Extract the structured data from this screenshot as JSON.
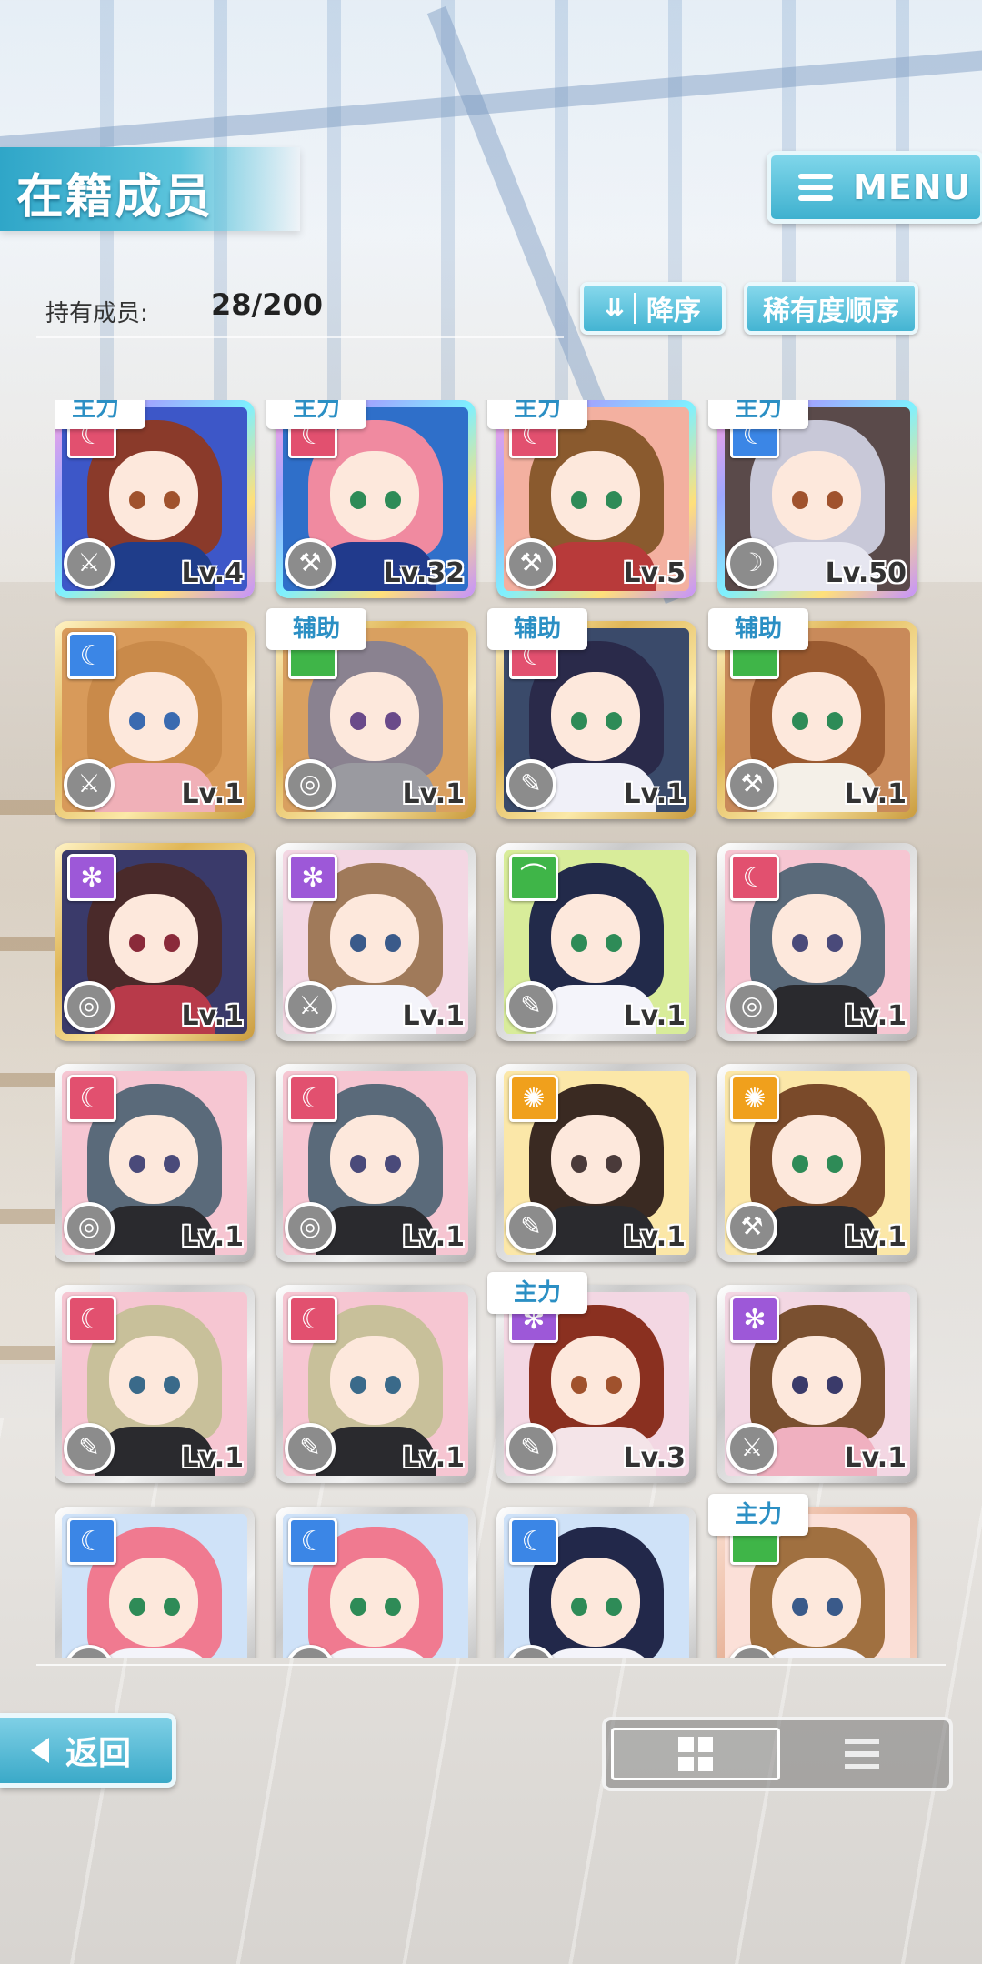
{
  "header": {
    "title": "在籍成员",
    "menu_label": "MENU"
  },
  "summary": {
    "count_label": "持有成员:",
    "count_value": "28/200"
  },
  "sort": {
    "order_label": "降序",
    "order_icon": "double-chevron-down-icon",
    "rarity_label": "稀有度顺序"
  },
  "members": [
    {
      "frame": "rainbow",
      "attribute": "red",
      "weapon": "sword",
      "level": "Lv.4",
      "role": "主力",
      "hair": "#8a3a2a",
      "outfit": "#1f3d8a",
      "eye": "#a0522d",
      "bg": "#3d57c8"
    },
    {
      "frame": "rainbow",
      "attribute": "red",
      "weapon": "hammer",
      "level": "Lv.32",
      "role": "主力",
      "hair": "#f08aa0",
      "outfit": "#213a8c",
      "eye": "#2e8b57",
      "bg": "#2f6fc9"
    },
    {
      "frame": "rainbow",
      "attribute": "red",
      "weapon": "hammer",
      "level": "Lv.5",
      "role": "主力",
      "hair": "#8a5a2e",
      "outfit": "#b83a3a",
      "eye": "#2e8b57",
      "bg": "#f3b0a0"
    },
    {
      "frame": "rainbow",
      "attribute": "blue",
      "weapon": "claw",
      "level": "Lv.50",
      "role": "主力",
      "hair": "#c8c8d8",
      "outfit": "#e6e6f0",
      "eye": "#a0522d",
      "bg": "#5a4a4a"
    },
    {
      "frame": "gold",
      "attribute": "blue",
      "weapon": "sword",
      "level": "Lv.1",
      "role": "",
      "hair": "#c98a4a",
      "outfit": "#f0b0b8",
      "eye": "#3a6ab0",
      "bg": "#d89a5a"
    },
    {
      "frame": "gold",
      "attribute": "green",
      "weapon": "shield",
      "level": "Lv.1",
      "role": "辅助",
      "hair": "#8a8290",
      "outfit": "#9a9aa0",
      "eye": "#6a4a8a",
      "bg": "#d9a060"
    },
    {
      "frame": "gold",
      "attribute": "red",
      "weapon": "gun",
      "level": "Lv.1",
      "role": "辅助",
      "hair": "#2a2a4a",
      "outfit": "#f0f0f8",
      "eye": "#2e8b57",
      "bg": "#3a4a6a"
    },
    {
      "frame": "gold",
      "attribute": "green",
      "weapon": "hammer",
      "level": "Lv.1",
      "role": "辅助",
      "hair": "#9a5a30",
      "outfit": "#f4f0e8",
      "eye": "#2e8b57",
      "bg": "#c98a5a"
    },
    {
      "frame": "gold",
      "attribute": "purple",
      "weapon": "shield",
      "level": "Lv.1",
      "role": "",
      "hair": "#4a2a2a",
      "outfit": "#b83a4a",
      "eye": "#8a2a3a",
      "bg": "#3a3a6a"
    },
    {
      "frame": "silver",
      "attribute": "purple",
      "weapon": "sword",
      "level": "Lv.1",
      "role": "",
      "hair": "#a07a5a",
      "outfit": "#f4f4fa",
      "eye": "#3a5a8a",
      "bg": "#f3d7e3"
    },
    {
      "frame": "silver",
      "attribute": "green",
      "weapon": "gun",
      "level": "Lv.1",
      "role": "",
      "hair": "#222a4a",
      "outfit": "#f4f4fa",
      "eye": "#2e8b57",
      "bg": "#d8ec9a"
    },
    {
      "frame": "silver",
      "attribute": "red",
      "weapon": "shield",
      "level": "Lv.1",
      "role": "",
      "hair": "#5a6a7a",
      "outfit": "#2a2a2e",
      "eye": "#4a4a7a",
      "bg": "#f6c6d2"
    },
    {
      "frame": "silver",
      "attribute": "red",
      "weapon": "shield",
      "level": "Lv.1",
      "role": "",
      "hair": "#5a6a7a",
      "outfit": "#2a2a2e",
      "eye": "#4a4a7a",
      "bg": "#f6c6d2"
    },
    {
      "frame": "silver",
      "attribute": "red",
      "weapon": "shield",
      "level": "Lv.1",
      "role": "",
      "hair": "#5a6a7a",
      "outfit": "#2a2a2e",
      "eye": "#4a4a7a",
      "bg": "#f6c6d2"
    },
    {
      "frame": "silver",
      "attribute": "orange",
      "weapon": "gun",
      "level": "Lv.1",
      "role": "",
      "hair": "#3a2a22",
      "outfit": "#2a2a2e",
      "eye": "#4a3a3a",
      "bg": "#fbe7a8"
    },
    {
      "frame": "silver",
      "attribute": "orange",
      "weapon": "hammer",
      "level": "Lv.1",
      "role": "",
      "hair": "#7a4a2a",
      "outfit": "#2a2a2e",
      "eye": "#2e8b57",
      "bg": "#fbe7a8"
    },
    {
      "frame": "silver",
      "attribute": "red",
      "weapon": "gun",
      "level": "Lv.1",
      "role": "",
      "hair": "#c8c09a",
      "outfit": "#2a2a2e",
      "eye": "#3a6a8a",
      "bg": "#f6c6d2"
    },
    {
      "frame": "silver",
      "attribute": "red",
      "weapon": "gun",
      "level": "Lv.1",
      "role": "",
      "hair": "#c8c09a",
      "outfit": "#2a2a2e",
      "eye": "#3a6a8a",
      "bg": "#f6c6d2"
    },
    {
      "frame": "silver",
      "attribute": "purple",
      "weapon": "gun",
      "level": "Lv.3",
      "role": "主力",
      "hair": "#8a3020",
      "outfit": "#f4e4e8",
      "eye": "#a0522d",
      "bg": "#f3d7e3"
    },
    {
      "frame": "silver",
      "attribute": "purple",
      "weapon": "sword",
      "level": "Lv.1",
      "role": "",
      "hair": "#7a5030",
      "outfit": "#f0b0c0",
      "eye": "#3a3a6a",
      "bg": "#f3d7e3"
    },
    {
      "frame": "silver",
      "attribute": "blue",
      "weapon": "shield",
      "level": "",
      "role": "",
      "hair": "#f07a90",
      "outfit": "#f4f4fa",
      "eye": "#2e8b57",
      "bg": "#cfe2f8"
    },
    {
      "frame": "silver",
      "attribute": "blue",
      "weapon": "shield",
      "level": "",
      "role": "",
      "hair": "#f07a90",
      "outfit": "#f4f4fa",
      "eye": "#2e8b57",
      "bg": "#cfe2f8"
    },
    {
      "frame": "silver",
      "attribute": "blue",
      "weapon": "gun",
      "level": "",
      "role": "",
      "hair": "#22284a",
      "outfit": "#f4f4fa",
      "eye": "#2e8b57",
      "bg": "#cfe2f8"
    },
    {
      "frame": "copper",
      "attribute": "green",
      "weapon": "sword",
      "level": "",
      "role": "主力",
      "hair": "#a07040",
      "outfit": "#f4f4fa",
      "eye": "#3a5a8a",
      "bg": "#fbe0d8"
    }
  ],
  "footer": {
    "back_label": "返回",
    "view_grid_icon": "grid-view-icon",
    "view_list_icon": "list-view-icon"
  }
}
